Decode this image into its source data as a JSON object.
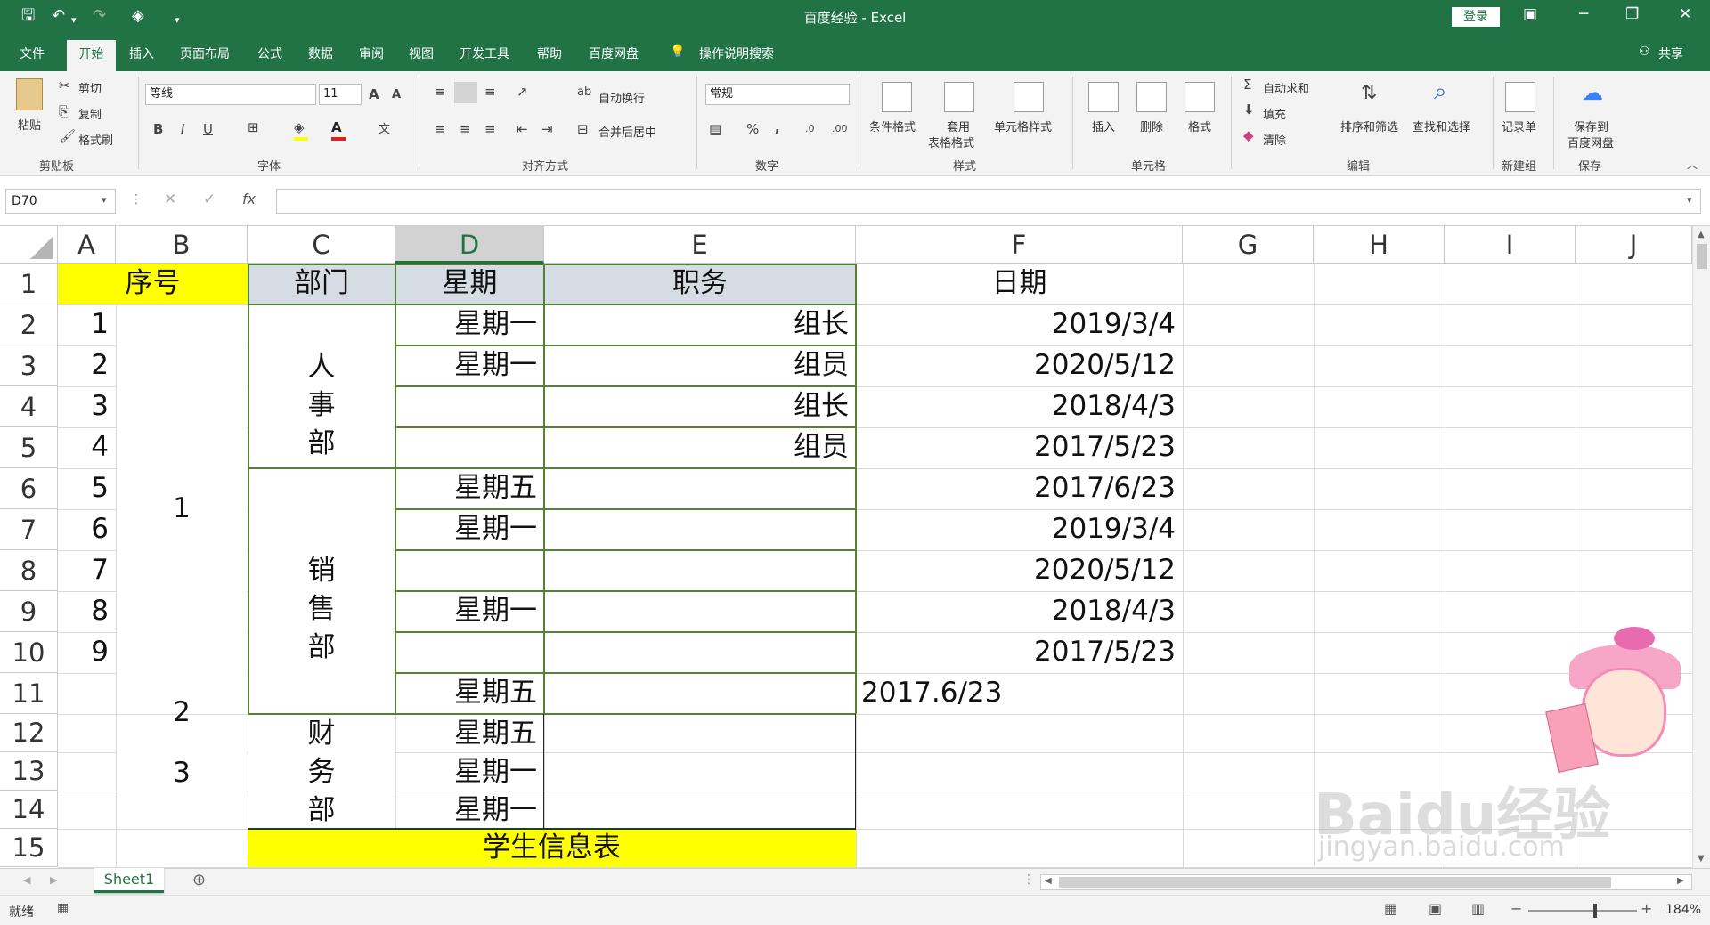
{
  "window": {
    "title": "百度经验  -  Excel",
    "login": "登录"
  },
  "menu": {
    "file": "文件",
    "home": "开始",
    "insert": "插入",
    "layout": "页面布局",
    "formula": "公式",
    "data": "数据",
    "review": "审阅",
    "view": "视图",
    "dev": "开发工具",
    "help": "帮助",
    "baidu": "百度网盘",
    "tell": "操作说明搜索",
    "share": "共享"
  },
  "ribbon": {
    "paste": "粘贴",
    "cut": "剪切",
    "copy": "复制",
    "painter": "格式刷",
    "clipboard": "剪贴板",
    "font_name": "等线",
    "font_size": "11",
    "font_group": "字体",
    "wrap": "自动换行",
    "merge": "合并后居中",
    "align_group": "对齐方式",
    "num_format": "常规",
    "num_group": "数字",
    "cond": "条件格式",
    "table1": "套用",
    "table2": "表格格式",
    "cellstyle": "单元格样式",
    "style_group": "样式",
    "ins": "插入",
    "del": "删除",
    "fmt": "格式",
    "cells_group": "单元格",
    "autosum": "自动求和",
    "fill": "填充",
    "clear": "清除",
    "sort": "排序和筛选",
    "find": "查找和选择",
    "edit_group": "编辑",
    "record": "记录单",
    "newgroup": "新建组",
    "save1": "保存到",
    "save2": "百度网盘",
    "save_group": "保存"
  },
  "formula_bar": {
    "name_box": "D70",
    "fx": "fx",
    "value": ""
  },
  "columns": [
    "A",
    "B",
    "C",
    "D",
    "E",
    "F",
    "G",
    "H",
    "I",
    "J"
  ],
  "rows": [
    "1",
    "2",
    "3",
    "4",
    "5",
    "6",
    "7",
    "8",
    "9",
    "10",
    "11",
    "12",
    "13",
    "14",
    "15"
  ],
  "cells": {
    "B1": "序号",
    "C1": "部门",
    "D1": "星期",
    "E1": "职务",
    "F1": "日期",
    "A2": "1",
    "A3": "2",
    "A4": "3",
    "A5": "4",
    "A6": "5",
    "A7": "6",
    "A8": "7",
    "A9": "8",
    "A10": "9",
    "B_1": "1",
    "B_2": "2",
    "B_3": "3",
    "C_hr": [
      "人",
      "事",
      "部"
    ],
    "C_sales": [
      "销",
      "售",
      "部"
    ],
    "C_fin": [
      "财",
      "务",
      "部"
    ],
    "D2": "星期一",
    "D3": "星期一",
    "D6": "星期五",
    "D7": "星期一",
    "D9": "星期一",
    "D11": "星期五",
    "D12": "星期五",
    "D13": "星期一",
    "D14": "星期一",
    "E2": "组长",
    "E3": "组员",
    "E4": "组长",
    "E5": "组员",
    "F2": "2019/3/4",
    "F3": "2020/5/12",
    "F4": "2018/4/3",
    "F5": "2017/5/23",
    "F6": "2017/6/23",
    "F7": "2019/3/4",
    "F8": "2020/5/12",
    "F9": "2018/4/3",
    "F10": "2017/5/23",
    "F11": "2017.6/23",
    "C15": "学生信息表"
  },
  "sheet_tab": "Sheet1",
  "status": {
    "ready": "就绪",
    "zoom": "184%"
  },
  "watermark": {
    "brand": "Baidu经验",
    "url": "jingyan.baidu.com"
  },
  "colors": {
    "excel_green": "#217346",
    "yellow": "#ffff00",
    "header_blue": "#d6dce4",
    "border_green": "#548235"
  }
}
